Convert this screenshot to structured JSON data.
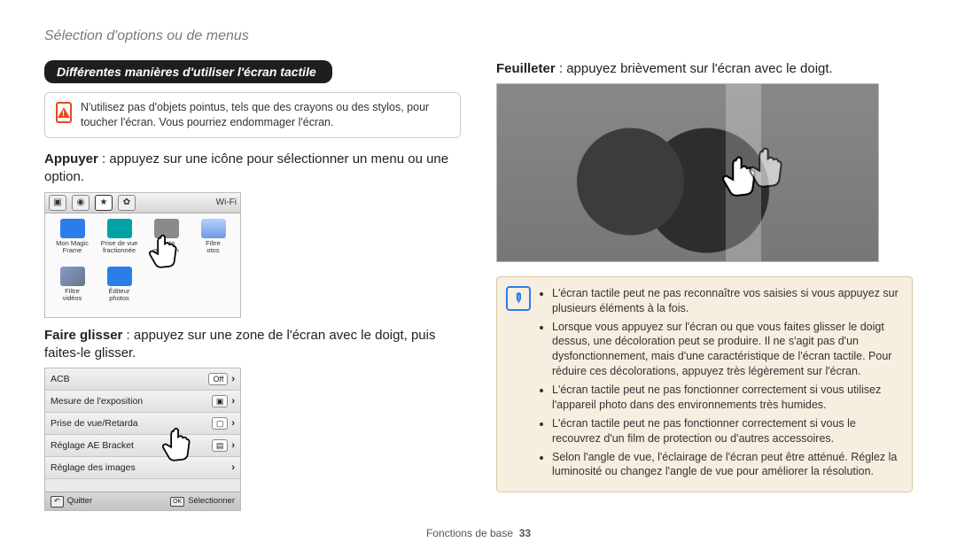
{
  "breadcrumb": "Sélection d'options ou de menus",
  "left": {
    "heading_pill": "Différentes manières d'utiliser l'écran tactile",
    "warning_text": "N'utilisez pas d'objets pointus, tels que des crayons ou des stylos, pour toucher l'écran. Vous pourriez endommager l'écran.",
    "tap_label": "Appuyer",
    "tap_desc": " : appuyez sur une icône pour sélectionner un menu ou une option.",
    "drag_label": "Faire glisser",
    "drag_desc": " : appuyez sur une zone de l'écran avec le doigt, puis faites-le glisser.",
    "shotA": {
      "wifi": "Wi-Fi",
      "cells": [
        {
          "l1": "Mon Magic",
          "l2": "Frame"
        },
        {
          "l1": "Prise de vue",
          "l2": "fractionnée"
        },
        {
          "l1": "Photo",
          "l2": "mouvem"
        },
        {
          "l1": "Filtre",
          "l2": "otos"
        },
        {
          "l1": "Filtre",
          "l2": "vidéos"
        },
        {
          "l1": "Éditeur",
          "l2": "photos"
        }
      ]
    },
    "shotB": {
      "rows": [
        {
          "label": "ACB",
          "badge": "Off"
        },
        {
          "label": "Mesure de l'exposition",
          "badge": ""
        },
        {
          "label": "Prise de vue/Retarda",
          "badge": ""
        },
        {
          "label": "Réglage AE Bracket",
          "badge": ""
        },
        {
          "label": "Réglage des images",
          "badge": ""
        }
      ],
      "back": "Quitter",
      "ok": "OK",
      "select": "Sélectionner"
    }
  },
  "right": {
    "flick_label": "Feuilleter",
    "flick_desc": " : appuyez brièvement sur l'écran avec le doigt.",
    "notes": [
      "L'écran tactile peut ne pas reconnaître vos saisies si vous appuyez sur plusieurs éléments à la fois.",
      "Lorsque vous appuyez sur l'écran ou que vous faites glisser le doigt dessus, une décoloration peut se produire. Il ne s'agit pas d'un dysfonctionnement, mais d'une caractéristique de l'écran tactile. Pour réduire ces décolorations, appuyez très légèrement sur l'écran.",
      "L'écran tactile peut ne pas fonctionner correctement si vous utilisez l'appareil photo dans des environnements très humides.",
      "L'écran tactile peut ne pas fonctionner correctement si vous le recouvrez d'un film de protection ou d'autres accessoires.",
      "Selon l'angle de vue, l'éclairage de l'écran peut être atténué. Réglez la luminosité ou changez l'angle de vue pour améliorer la résolution."
    ]
  },
  "footer": {
    "section": "Fonctions de base",
    "page": "33"
  }
}
